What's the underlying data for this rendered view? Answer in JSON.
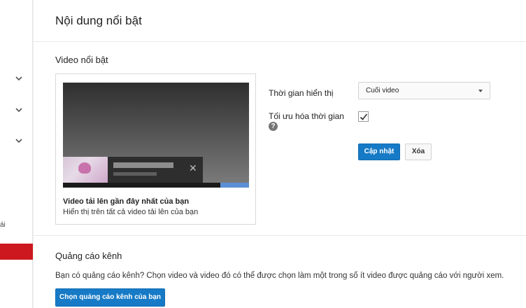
{
  "sidebar": {
    "expanders": [
      "chevron-down-icon",
      "chevron-down-icon",
      "chevron-down-icon"
    ],
    "partial_label": "ái",
    "active_color": "#cc181e"
  },
  "page": {
    "title": "Nội dung nổi bật"
  },
  "featured_video": {
    "section_title": "Video nổi bật",
    "card_title": "Video tải lên gần đây nhất của bạn",
    "card_subtitle": "Hiển thị trên tất cả video tải lên của bạn",
    "close_glyph": "✕",
    "display_time_label": "Thời gian hiển thị",
    "display_time_value": "Cuối video",
    "optimize_label": "Tối ưu hóa thời gian",
    "optimize_checked": true,
    "help_glyph": "?",
    "update_button": "Cập nhật",
    "delete_button": "Xóa"
  },
  "channel_promo": {
    "section_title": "Quảng cáo kênh",
    "description": "Bạn có quảng cáo kênh? Chọn video và video đó có thể được chọn làm một trong số ít video được quảng cáo với người xem.",
    "button": "Chọn quảng cáo kênh của bạn"
  },
  "colors": {
    "primary": "#167ac6",
    "progress": "#5b8fd6"
  }
}
